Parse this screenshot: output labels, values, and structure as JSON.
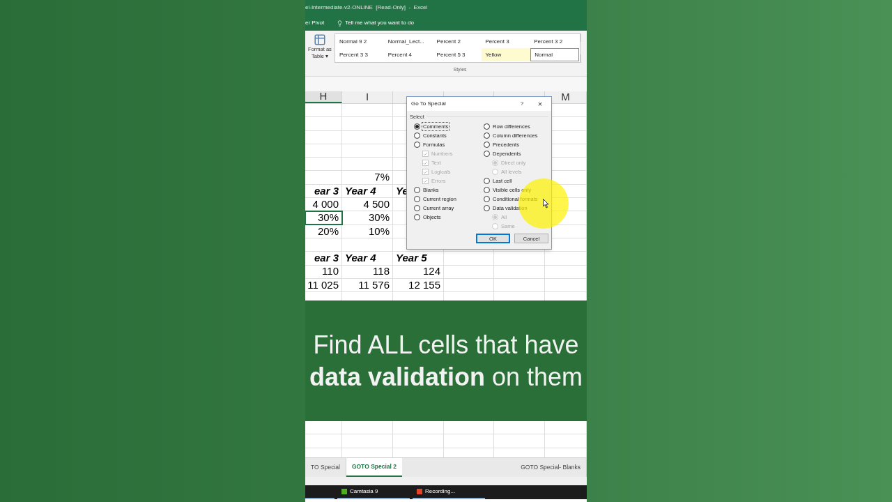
{
  "window": {
    "title": "el-Intermediate-v2-ONLINE  [Read-Only]  -  Excel"
  },
  "ribbon": {
    "tab_fragment": "er Pivot",
    "tell_me": "Tell me what you want to do",
    "format_as_table": [
      "Format as",
      "Table ▾"
    ],
    "styles": [
      {
        "label": "Normal 9 2",
        "color": "#ffffff",
        "selected": false
      },
      {
        "label": "Normal_Lect...",
        "color": "#ffffff",
        "selected": false
      },
      {
        "label": "Percent 2",
        "color": "#ffffff",
        "selected": false
      },
      {
        "label": "Percent 3",
        "color": "#ffffff",
        "selected": false
      },
      {
        "label": "Percent 3 2",
        "color": "#ffffff",
        "selected": false
      },
      {
        "label": "Percent 3 3",
        "color": "#ffffff",
        "selected": false
      },
      {
        "label": "Percent 4",
        "color": "#ffffff",
        "selected": false
      },
      {
        "label": "Percent 5 3",
        "color": "#ffffff",
        "selected": false
      },
      {
        "label": "Yellow",
        "color": "#fffbd0",
        "selected": false
      },
      {
        "label": "Normal",
        "color": "#ffffff",
        "selected": true
      }
    ],
    "group_label": "Styles"
  },
  "columns": [
    "H",
    "I",
    null,
    null,
    null,
    "M"
  ],
  "rows": [
    {
      "kind": "blank"
    },
    {
      "kind": "blank"
    },
    {
      "kind": "blank"
    },
    {
      "kind": "blank"
    },
    {
      "kind": "blank"
    },
    {
      "kind": "value",
      "cells": [
        {
          "selected": false
        },
        {
          "text": "7%",
          "selected": false
        }
      ]
    },
    {
      "kind": "header",
      "cells": [
        {
          "text": "ear 3",
          "selected": false
        },
        {
          "text": "Year 4",
          "selected": false
        },
        {
          "text": "Ye",
          "selected": false
        }
      ]
    },
    {
      "kind": "value",
      "cells": [
        {
          "text": "4 000",
          "selected": false
        },
        {
          "text": "4 500",
          "selected": false
        }
      ]
    },
    {
      "kind": "value",
      "cells": [
        {
          "text": "30%",
          "selected": true
        },
        {
          "text": "30%",
          "selected": false
        }
      ]
    },
    {
      "kind": "value",
      "cells": [
        {
          "text": "20%",
          "selected": false
        },
        {
          "text": "10%",
          "selected": false
        }
      ]
    },
    {
      "kind": "blank"
    },
    {
      "kind": "header",
      "cells": [
        {
          "text": "ear 3",
          "selected": false
        },
        {
          "text": "Year 4",
          "selected": false
        },
        {
          "text": "Year 5",
          "selected": false
        }
      ]
    },
    {
      "kind": "value",
      "cells": [
        {
          "text": "110",
          "selected": false
        },
        {
          "text": "118",
          "selected": false
        },
        {
          "text": "124",
          "selected": false
        }
      ]
    },
    {
      "kind": "value",
      "cells": [
        {
          "text": "11 025",
          "selected": false
        },
        {
          "text": "11 576",
          "selected": false
        },
        {
          "text": "12 155",
          "selected": false
        }
      ]
    },
    {
      "kind": "blank"
    }
  ],
  "dialog": {
    "title": "Go To Special",
    "help": "?",
    "close": "×",
    "group_label": "Select",
    "left": [
      {
        "kind": "radio",
        "label": "Comments",
        "selected": true,
        "disabled": false
      },
      {
        "kind": "radio",
        "label": "Constants",
        "selected": false,
        "disabled": false
      },
      {
        "kind": "radio",
        "label": "Formulas",
        "selected": false,
        "disabled": false,
        "children": [
          {
            "kind": "checkbox",
            "label": "Numbers",
            "checked": true,
            "disabled": true
          },
          {
            "kind": "checkbox",
            "label": "Text",
            "checked": true,
            "disabled": true
          },
          {
            "kind": "checkbox",
            "label": "Logicals",
            "checked": true,
            "disabled": true
          },
          {
            "kind": "checkbox",
            "label": "Errors",
            "checked": true,
            "disabled": true
          }
        ]
      },
      {
        "kind": "radio",
        "label": "Blanks",
        "selected": false,
        "disabled": false
      },
      {
        "kind": "radio",
        "label": "Current region",
        "selected": false,
        "disabled": false
      },
      {
        "kind": "radio",
        "label": "Current array",
        "selected": false,
        "disabled": false
      },
      {
        "kind": "radio",
        "label": "Objects",
        "selected": false,
        "disabled": false
      }
    ],
    "right": [
      {
        "kind": "radio",
        "label": "Row differences",
        "selected": false,
        "disabled": false
      },
      {
        "kind": "radio",
        "label": "Column differences",
        "selected": false,
        "disabled": false
      },
      {
        "kind": "radio",
        "label": "Precedents",
        "selected": false,
        "disabled": false
      },
      {
        "kind": "radio",
        "label": "Dependents",
        "selected": false,
        "disabled": false,
        "children": [
          {
            "kind": "radio",
            "label": "Direct only",
            "selected": true,
            "disabled": true
          },
          {
            "kind": "radio",
            "label": "All levels",
            "selected": false,
            "disabled": true
          }
        ]
      },
      {
        "kind": "radio",
        "label": "Last cell",
        "selected": false,
        "disabled": false
      },
      {
        "kind": "radio",
        "label": "Visible cells only",
        "selected": false,
        "disabled": false
      },
      {
        "kind": "radio",
        "label": "Conditional formats",
        "selected": false,
        "disabled": false
      },
      {
        "kind": "radio",
        "label": "Data validation",
        "selected": false,
        "disabled": false,
        "children": [
          {
            "kind": "radio",
            "label": "All",
            "selected": true,
            "disabled": true
          },
          {
            "kind": "radio",
            "label": "Same",
            "selected": false,
            "disabled": true
          }
        ]
      }
    ],
    "buttons": [
      {
        "label": "OK",
        "selected": true
      },
      {
        "label": "Cancel",
        "selected": false
      }
    ]
  },
  "caption": "Find ALL cells that have **data validation** on them",
  "sheet_tabs": [
    {
      "label": "TO Special",
      "selected": false
    },
    {
      "label": "GOTO Special 2",
      "selected": true
    },
    {
      "label": "GOTO Special- Blanks",
      "selected": false
    }
  ],
  "taskbar": [
    {
      "label": "Camtasia 9",
      "color": "#4caf1e"
    },
    {
      "label": "Recording...",
      "color": "#e0452b"
    }
  ]
}
